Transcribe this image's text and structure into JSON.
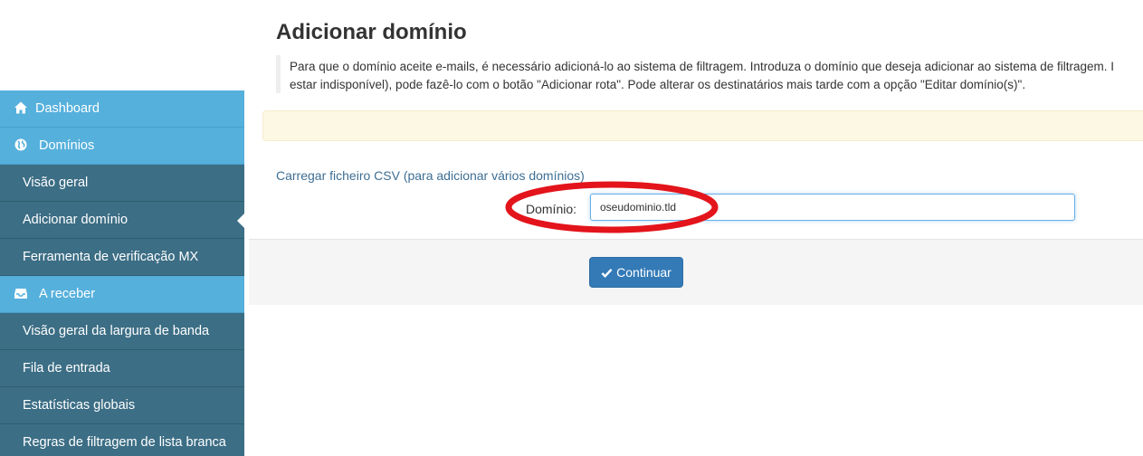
{
  "sidebar": {
    "items": [
      {
        "label": "Dashboard",
        "type": "section",
        "icon": "home-icon"
      },
      {
        "label": "Domínios",
        "type": "section",
        "icon": "globe-icon"
      },
      {
        "label": "Visão geral",
        "type": "item"
      },
      {
        "label": "Adicionar domínio",
        "type": "item",
        "active": true
      },
      {
        "label": "Ferramenta de verificação MX",
        "type": "item"
      },
      {
        "label": "A receber",
        "type": "section",
        "icon": "inbox-icon"
      },
      {
        "label": "Visão geral da largura de banda",
        "type": "item"
      },
      {
        "label": "Fila de entrada",
        "type": "item"
      },
      {
        "label": "Estatísticas globais",
        "type": "item"
      },
      {
        "label": "Regras de filtragem de lista branca",
        "type": "item"
      }
    ]
  },
  "main": {
    "title": "Adicionar domínio",
    "description_line1": "Para que o domínio aceite e-mails, é necessário adicioná-lo ao sistema de filtragem. Introduza o domínio que deseja adicionar ao sistema de filtragem. I",
    "description_line2": "estar indisponível), pode fazê-lo com o botão \"Adicionar rota\". Pode alterar os destinatários mais tarde com a opção \"Editar domínio(s)\".",
    "csv_link": "Carregar ficheiro CSV (para adicionar vários domínios)",
    "domain_label": "Domínio:",
    "domain_value": "oseudominio.tld",
    "continue_button": "Continuar"
  },
  "colors": {
    "sidebar_section": "#55b0dc",
    "sidebar_item": "#3c6e85",
    "primary_button": "#337ab7",
    "annotation_ellipse": "#e3141b",
    "alert_background": "#fcf8e3"
  }
}
